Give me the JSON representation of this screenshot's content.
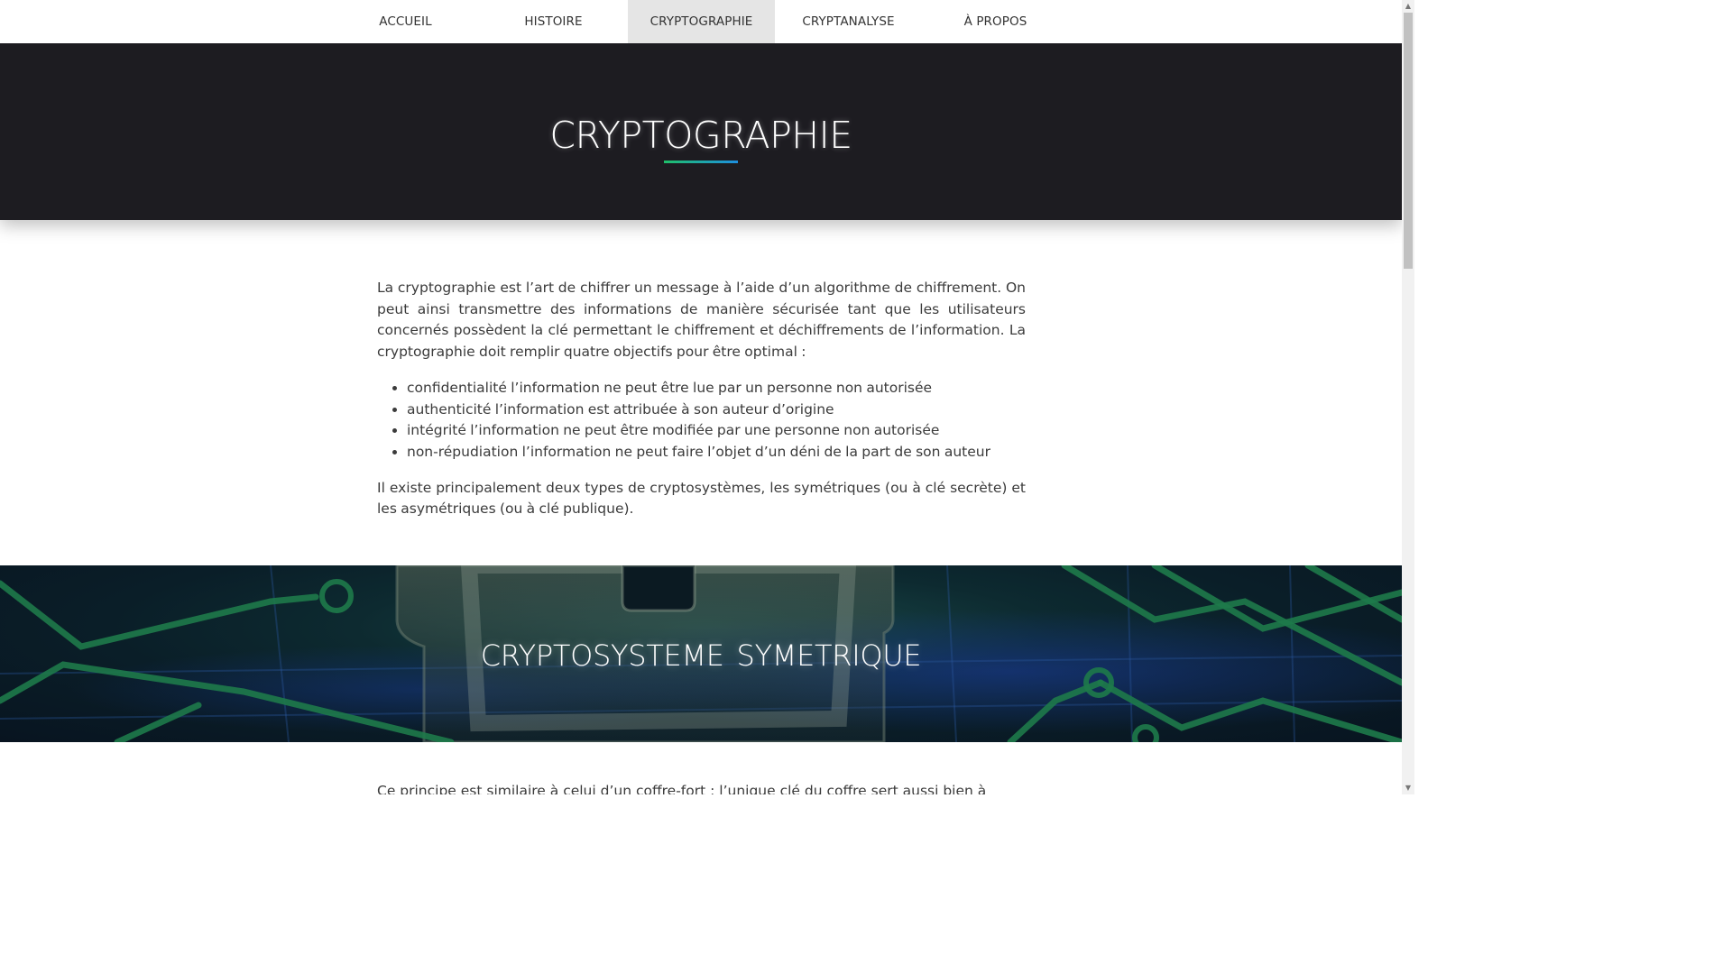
{
  "nav": {
    "items": [
      {
        "label": "ACCUEIL"
      },
      {
        "label": "HISTOIRE"
      },
      {
        "label": "CRYPTOGRAPHIE"
      },
      {
        "label": "CRYPTANALYSE"
      },
      {
        "label": "À PROPOS"
      }
    ],
    "active_index": 2
  },
  "hero": {
    "title": "CRYPTOGRAPHIE",
    "underline_gradient": [
      "#1fbf6a",
      "#1e8fe0"
    ],
    "background": "#1d1c21"
  },
  "article": {
    "intro": "La cryptographie est l’art de chiffrer un message à l’aide d’un algorithme de chiffrement. On peut ainsi transmettre des informations de manière sécurisée tant que les utilisateurs concernés possèdent la clé permettant le chiffrement et déchiffrements de l’information. La cryptographie doit remplir quatre objectifs pour être optimal :",
    "objectives": [
      "confidentialité l’information ne peut être lue par un personne non autorisée",
      "authenticité l’information est attribuée à son auteur d’origine",
      "intégrité l’information ne peut être modifiée par une personne non autorisée",
      "non-répudiation l’information ne peut faire l’objet d’un déni de la part de son auteur"
    ],
    "conclusion": "Il existe principalement deux types de cryptosystèmes, les symétriques (ou à clé secrète) et les asymétriques (ou à clé publique)."
  },
  "banner": {
    "title": "CRYPTOSYSTEME SYMETRIQUE"
  },
  "next_section": {
    "partial_text": "Ce principe est similaire à celui d’un coffre-fort : l’unique clé du coffre sert aussi bien à l’ouvrir qu’à"
  },
  "colors": {
    "accent_green": "#1fbf6a",
    "accent_blue": "#1e8fe0",
    "nav_active_bg": "#e5e5e5"
  }
}
